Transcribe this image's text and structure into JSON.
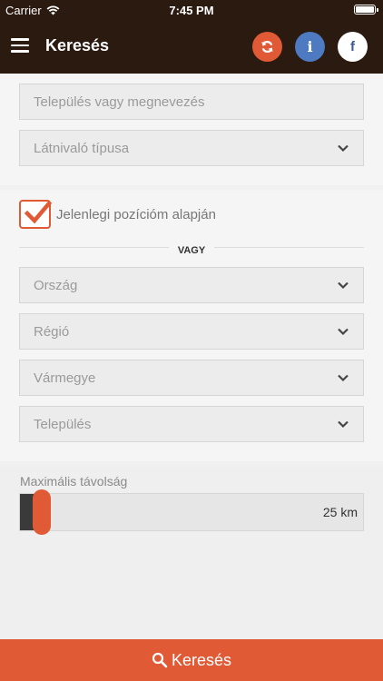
{
  "status_bar": {
    "carrier": "Carrier",
    "time": "7:45 PM",
    "battery_level": 1.0
  },
  "navbar": {
    "title": "Keresés",
    "menu_icon": "hamburger-icon",
    "actions": [
      {
        "icon": "refresh-icon",
        "color": "#e05a35"
      },
      {
        "icon": "info-icon",
        "label": "i",
        "color": "#4e7ac2"
      },
      {
        "icon": "facebook-icon",
        "label": "f",
        "color": "#ffffff"
      }
    ]
  },
  "search": {
    "place_placeholder": "Település vagy megnevezés",
    "type_placeholder": "Látnivaló típusa"
  },
  "location": {
    "checkbox_label": "Jelenlegi pozícióm alapján",
    "checked": true,
    "or_label": "VAGY",
    "country_placeholder": "Ország",
    "region_placeholder": "Régió",
    "county_placeholder": "Vármegye",
    "settlement_placeholder": "Település"
  },
  "distance": {
    "label": "Maximális távolság",
    "value_text": "25 km",
    "value_km": 25,
    "fraction": 0.063
  },
  "footer": {
    "search_label": "Keresés",
    "accent_color": "#e05a35"
  }
}
